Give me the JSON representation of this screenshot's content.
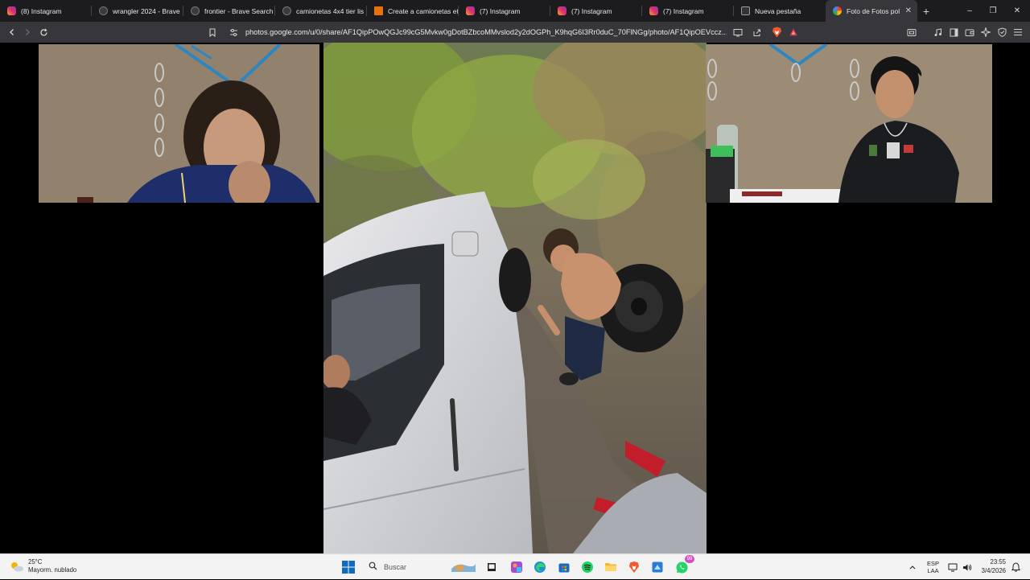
{
  "tabs": [
    {
      "title": "(8) Instagram",
      "favicon": "instagram-icon",
      "active": false
    },
    {
      "title": "wrangler 2024 - Brave",
      "favicon": "brave-search-icon",
      "active": false
    },
    {
      "title": "frontier - Brave Search",
      "favicon": "brave-search-icon",
      "active": false
    },
    {
      "title": "camionetas 4x4 tier lis",
      "favicon": "brave-search-icon",
      "active": false
    },
    {
      "title": "Create a camionetas et",
      "favicon": "document-icon",
      "active": false
    },
    {
      "title": "(7) Instagram",
      "favicon": "instagram-icon",
      "active": false
    },
    {
      "title": "(7) Instagram",
      "favicon": "instagram-icon",
      "active": false
    },
    {
      "title": "(7) Instagram",
      "favicon": "instagram-icon",
      "active": false
    },
    {
      "title": "Nueva pestaña",
      "favicon": "new-tab-icon",
      "active": false
    },
    {
      "title": "Foto de Fotos pol",
      "favicon": "google-photos-icon",
      "active": true
    }
  ],
  "window_controls": {
    "new_tab": "+",
    "minimize": "–",
    "maximize": "❐",
    "close": "✕",
    "tab_close": "✕"
  },
  "address_bar": {
    "url": "photos.google.com/u/0/share/AF1QipPOwQGJc99cG5Mvkw0gDotBZbcoMMvslod2y2dOGPh_K9hqG6I3Rr0duC_70FlNGg/photo/AF1QipOEVccz..."
  },
  "taskbar": {
    "weather": {
      "temp": "25°C",
      "condition": "Mayorm. nublado"
    },
    "search_placeholder": "Buscar",
    "lang_top": "ESP",
    "lang_bottom": "LAA",
    "time": "23:55",
    "date": "3/4/2026",
    "notification_count": "99"
  }
}
